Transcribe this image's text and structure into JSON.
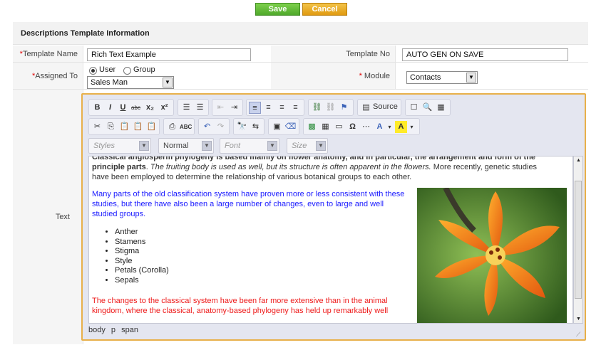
{
  "toolbar": {
    "save_label": "Save",
    "cancel_label": "Cancel"
  },
  "section": {
    "title": "Descriptions Template Information"
  },
  "form": {
    "template_name_label": "Template Name",
    "template_name_value": "Rich Text Example",
    "template_no_label": "Template No",
    "template_no_value": "AUTO GEN ON SAVE",
    "assigned_to_label": "Assigned To",
    "user_label": "User",
    "group_label": "Group",
    "assigned_value": "Sales Man",
    "module_label": "Module",
    "module_value": "Contacts",
    "text_label": "Text"
  },
  "editor": {
    "toolbar1": {
      "bold": "B",
      "italic": "I",
      "underline": "U",
      "strike": "abc",
      "subscript": "x₂",
      "superscript": "x²",
      "source_label": "Source"
    },
    "combos": {
      "styles": "Styles",
      "format": "Normal",
      "font": "Font",
      "size": "Size"
    },
    "content": {
      "top_line_partial": "Classical angiosperm phylogeny is based mainly on flower anatomy, and in particular, the arrangement and form of the",
      "bold_phrase": "principle parts",
      "italic_phrase": "The fruiting body is used as well, but its structure is often apparent in the flowers.",
      "para1_rest": "More recently, genetic studies have been employed to determine the relationship of various botanical groups to each other.",
      "blue_para": "Many parts of the old classification system have proven more or less consistent with these studies, but there have also been a large number of changes, even to large and well studied groups.",
      "list": [
        "Anther",
        "Stamens",
        "Stigma",
        "Style",
        "Petals (Corolla)",
        "Sepals"
      ],
      "red_para": "The changes to the classical system have been far more extensive than in the animal kingdom, where the classical, anatomy-based phylogeny has held up remarkably well"
    },
    "path": [
      "body",
      "p",
      "span"
    ]
  },
  "colors": {
    "blue_text": "#1a1aff",
    "red_text": "#ee1a1a",
    "editor_border": "#e8b04a"
  }
}
